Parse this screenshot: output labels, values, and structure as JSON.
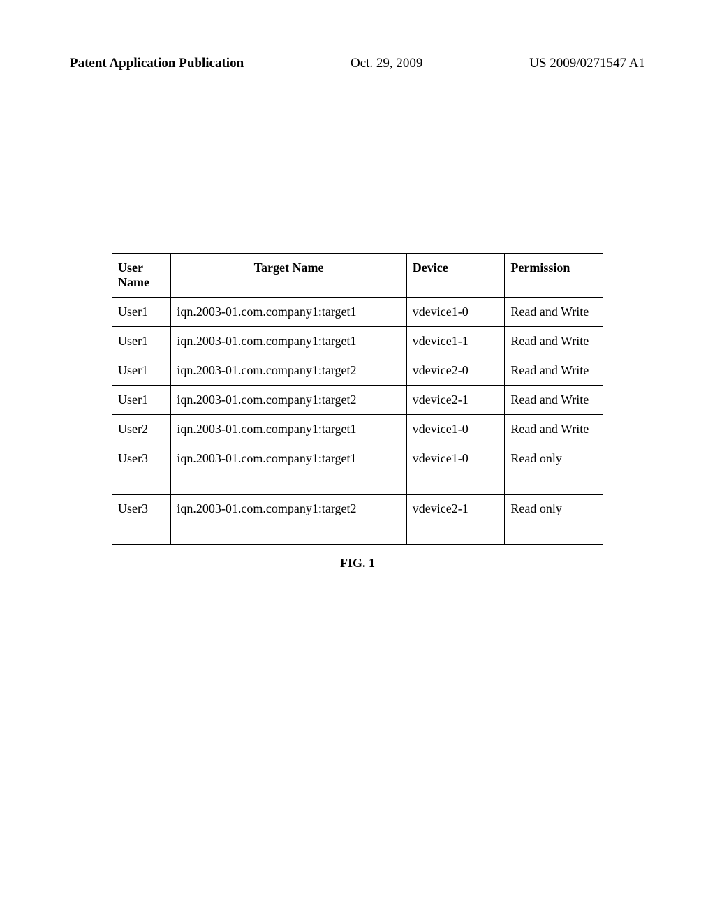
{
  "header": {
    "left": "Patent Application Publication",
    "center": "Oct. 29, 2009",
    "right": "US 2009/0271547 A1"
  },
  "table": {
    "headers": {
      "user_name": "User Name",
      "target_name": "Target Name",
      "device": "Device",
      "permission": "Permission"
    },
    "rows": [
      {
        "user_name": "User1",
        "target_name": "iqn.2003-01.com.company1:target1",
        "device": "vdevice1-0",
        "permission": "Read and Write"
      },
      {
        "user_name": "User1",
        "target_name": "iqn.2003-01.com.company1:target1",
        "device": "vdevice1-1",
        "permission": "Read and Write"
      },
      {
        "user_name": "User1",
        "target_name": "iqn.2003-01.com.company1:target2",
        "device": "vdevice2-0",
        "permission": "Read and Write"
      },
      {
        "user_name": "User1",
        "target_name": "iqn.2003-01.com.company1:target2",
        "device": "vdevice2-1",
        "permission": "Read and Write"
      },
      {
        "user_name": "User2",
        "target_name": "iqn.2003-01.com.company1:target1",
        "device": "vdevice1-0",
        "permission": "Read and Write"
      },
      {
        "user_name": "User3",
        "target_name": "iqn.2003-01.com.company1:target1",
        "device": "vdevice1-0",
        "permission": "Read only"
      },
      {
        "user_name": "User3",
        "target_name": "iqn.2003-01.com.company1:target2",
        "device": "vdevice2-1",
        "permission": "Read only"
      }
    ]
  },
  "figure_caption": "FIG. 1"
}
